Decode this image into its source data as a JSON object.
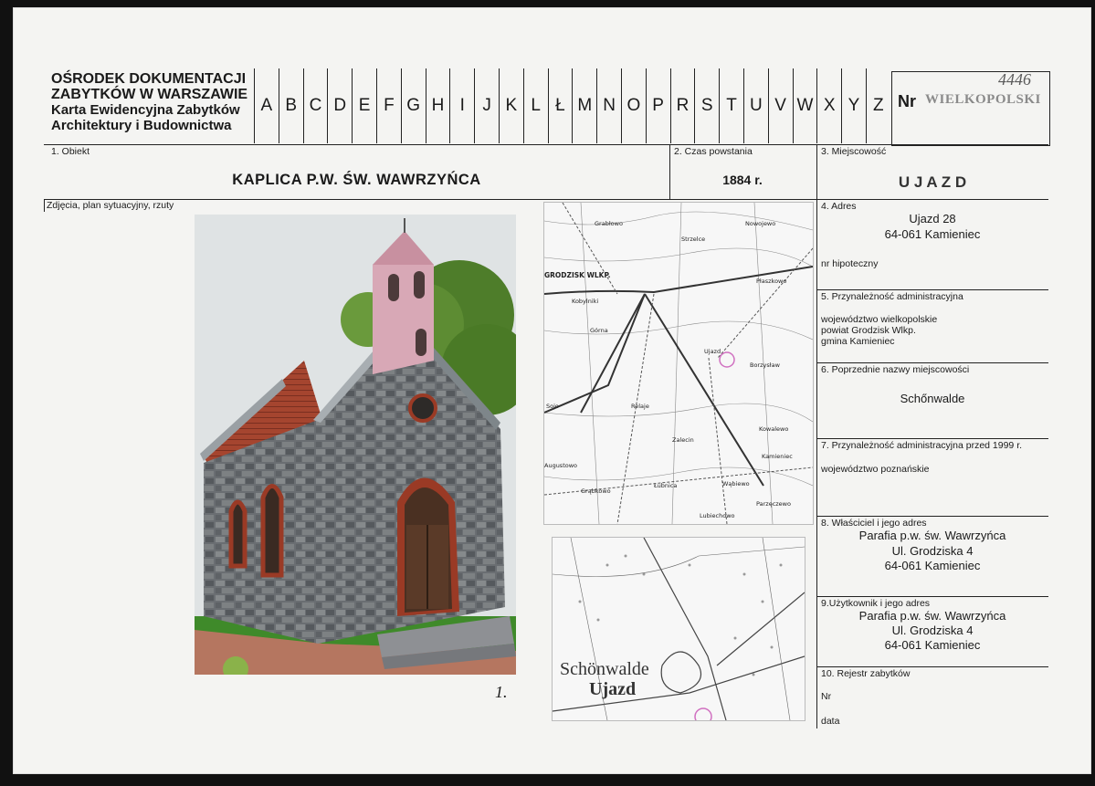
{
  "header": {
    "org_line1": "OŚRODEK DOKUMENTACJI",
    "org_line2": "ZABYTKÓW W WARSZAWIE",
    "org_line3": "Karta Ewidencyjna Zabytków",
    "org_line4": "Architektury i Budownictwa",
    "letters": [
      "A",
      "B",
      "C",
      "D",
      "E",
      "F",
      "G",
      "H",
      "I",
      "J",
      "K",
      "L",
      "Ł",
      "M",
      "N",
      "O",
      "P",
      "R",
      "S",
      "T",
      "U",
      "V",
      "W",
      "X",
      "Y",
      "Z"
    ],
    "nr_label": "Nr",
    "nr_value": "WIELKOPOLSKI",
    "nr_handwritten": "4446"
  },
  "field1": {
    "label": "1.    Obiekt",
    "value": "KAPLICA   P.W.   ŚW.   WAWRZYŃCA"
  },
  "field2": {
    "label": "2. Czas powstania",
    "value": "1884 r."
  },
  "field3": {
    "label": "3. Miejscowość",
    "value": "U J A Z D"
  },
  "photos": {
    "label": "Zdjęcia, plan sytuacyjny, rzuty",
    "caption": "1."
  },
  "maps": {
    "map1_labels": [
      "Grabłowo",
      "Strzelce",
      "Nowojewo",
      "GRODZISK WLKP.",
      "Płaszkowo",
      "Kobylniki",
      "Górna",
      "Ujazd",
      "Borzysław",
      "Sojo",
      "Relaje",
      "Kowalewo",
      "Zalecin",
      "Kamieniec",
      "Augustowo",
      "Łubnica",
      "Wąbiewo",
      "Grąbkowo",
      "Parzęczewo",
      "Lubiechowo"
    ],
    "map2_labels": [
      "Schönwalde",
      "Ujazd"
    ]
  },
  "field4": {
    "label": "4. Adres",
    "line1": "Ujazd 28",
    "line2": "64-061 Kamieniec",
    "sub": "nr hipoteczny"
  },
  "field5": {
    "label": "5. Przynależność administracyjna",
    "line1": "województwo  wielkopolskie",
    "line2": "powiat Grodzisk Wlkp.",
    "line3": "gmina Kamieniec"
  },
  "field6": {
    "label": "6. Poprzednie nazwy miejscowości",
    "value": "Schőnwalde"
  },
  "field7": {
    "label": "7. Przynależność administracyjna przed 1999 r.",
    "value": "województwo poznańskie"
  },
  "field8": {
    "label": "8. Właściciel i jego adres",
    "line1": "Parafia p.w. św. Wawrzyńca",
    "line2": "Ul. Grodziska 4",
    "line3": "64-061 Kamieniec"
  },
  "field9": {
    "label": "9.Użytkownik i jego adres",
    "line1": "Parafia p.w. św. Wawrzyńca",
    "line2": "Ul. Grodziska 4",
    "line3": "64-061 Kamieniec"
  },
  "field10": {
    "label": "10. Rejestr zabytków",
    "nr": "Nr",
    "data": "data"
  }
}
